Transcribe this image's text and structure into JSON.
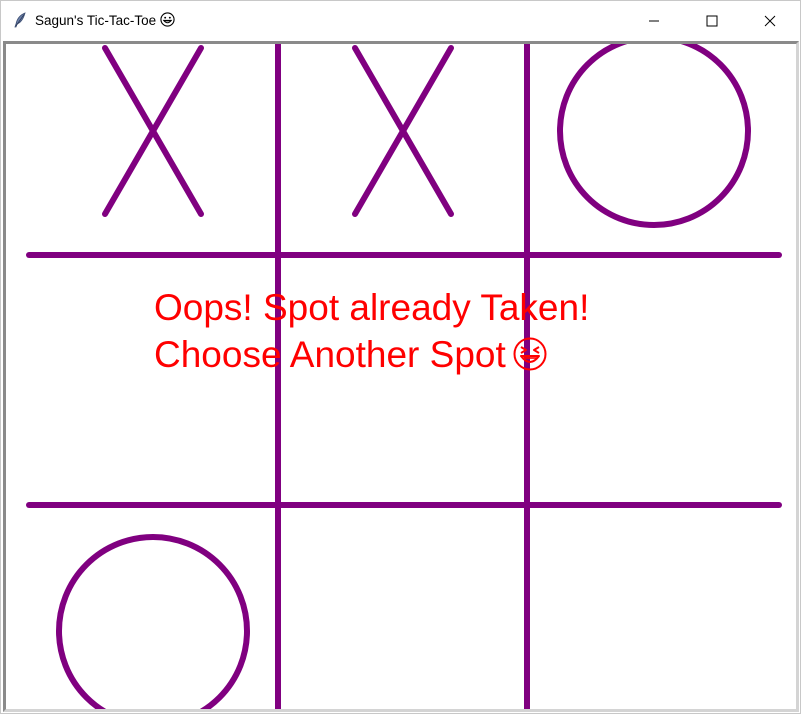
{
  "window": {
    "title": "Sagun's Tic-Tac-Toe",
    "title_emoji_icon": "grinning-face-icon",
    "app_icon": "feather-icon",
    "controls": [
      "minimize-icon",
      "maximize-icon",
      "close-icon"
    ]
  },
  "board": {
    "line_color": "#800080",
    "mark_color": "#800080",
    "cells": [
      [
        "X",
        "X",
        "O"
      ],
      [
        "",
        "",
        ""
      ],
      [
        "O",
        "",
        ""
      ]
    ]
  },
  "message": {
    "line1": "Oops! Spot already Taken!",
    "line2": "Choose Another Spot",
    "emoji_icon": "squinting-laughing-face-icon",
    "color": "#ff0000"
  }
}
